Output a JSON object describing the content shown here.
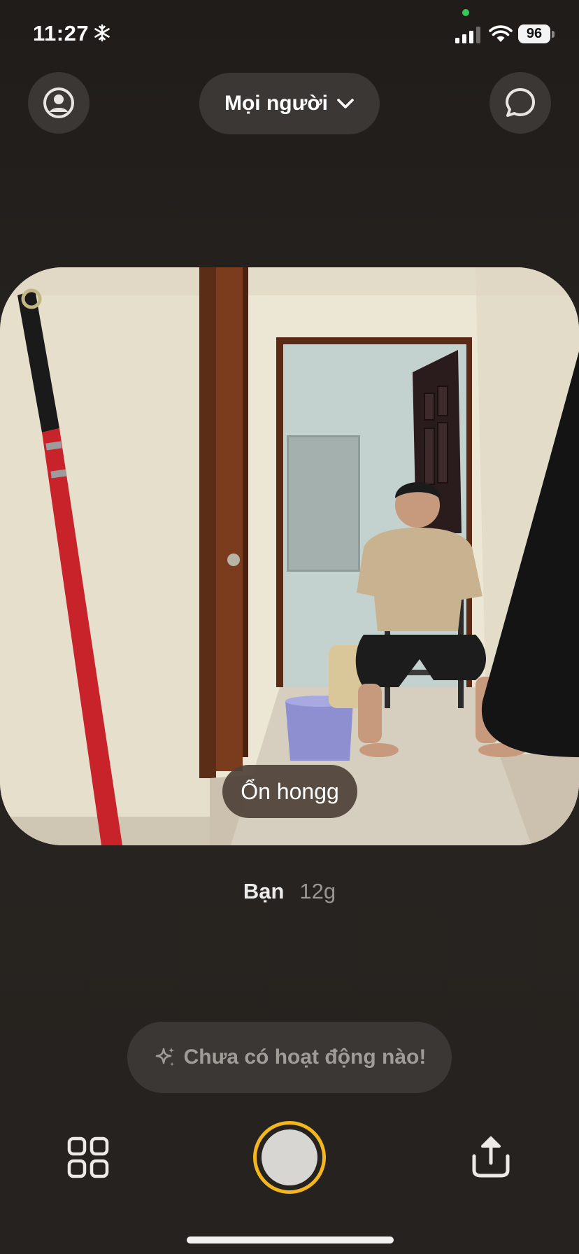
{
  "status_bar": {
    "time": "11:27",
    "battery": "96",
    "icons": [
      "snowflake-icon",
      "signal-icon",
      "wifi-icon",
      "battery-icon"
    ]
  },
  "header": {
    "audience_label": "Mọi người",
    "icons": [
      "profile-icon",
      "chevron-down-icon",
      "chat-icon"
    ]
  },
  "photo": {
    "caption": "Ổn hongg"
  },
  "sender": {
    "name": "Bạn",
    "time_ago": "12g"
  },
  "activity": {
    "text": "Chưa có hoạt động nào!",
    "icon": "sparkle-icon"
  },
  "bottom_bar": {
    "icons": [
      "grid-icon",
      "shutter-button",
      "share-icon"
    ]
  },
  "colors": {
    "background": "#252220",
    "button_bg": "#3a3734",
    "shutter_ring": "#f3b61f",
    "muted_text": "#9a9693"
  }
}
